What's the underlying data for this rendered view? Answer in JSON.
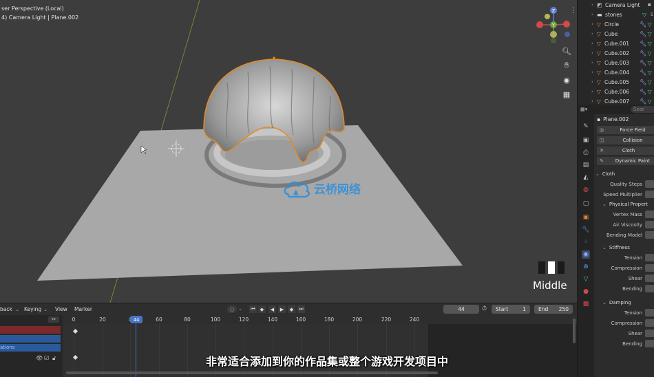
{
  "viewport": {
    "perspective_label": "ser Perspective (Local)",
    "object_label": "4) Camera Light | Plane.002",
    "view_mode_label": "Middle",
    "watermark_text": "云桥网络",
    "gizmo": {
      "z": "Z",
      "y": "Y",
      "x": "X"
    }
  },
  "outliner": {
    "items": [
      {
        "label": "Camera Light",
        "type": "camera"
      },
      {
        "label": "stones",
        "type": "collection",
        "badge": "5"
      },
      {
        "label": "Circle",
        "type": "mesh"
      },
      {
        "label": "Cube",
        "type": "mesh"
      },
      {
        "label": "Cube.001",
        "type": "mesh"
      },
      {
        "label": "Cube.002",
        "type": "mesh"
      },
      {
        "label": "Cube.003",
        "type": "mesh"
      },
      {
        "label": "Cube.004",
        "type": "mesh"
      },
      {
        "label": "Cube.005",
        "type": "mesh"
      },
      {
        "label": "Cube.006",
        "type": "mesh"
      },
      {
        "label": "Cube.007",
        "type": "mesh"
      }
    ]
  },
  "properties": {
    "search_placeholder": "Sear",
    "object_name": "Plane.002",
    "physics_buttons": [
      {
        "label": "Force Field",
        "icon": "force-field-icon"
      },
      {
        "label": "Collision",
        "icon": "collision-icon"
      },
      {
        "label": "Cloth",
        "icon": "close-icon",
        "active": true
      },
      {
        "label": "Dynamic Paint",
        "icon": "dynamic-paint-icon"
      }
    ],
    "cloth_section": "Cloth",
    "rows_top": [
      "Quality Steps",
      "Speed Multiplier"
    ],
    "physical_section": "Physical Propert",
    "rows_physical": [
      "Vertex Mass",
      "Air Viscosity",
      "Bending Model"
    ],
    "stiffness_section": "Stiffness",
    "rows_stiffness": [
      "Tension",
      "Compression",
      "Shear",
      "Bending"
    ],
    "damping_section": "Damping",
    "rows_damping": [
      "Tension",
      "Compression",
      "Shear",
      "Bending"
    ]
  },
  "timeline": {
    "menus": [
      "back",
      "Keying",
      "View",
      "Marker"
    ],
    "current_frame": "44",
    "start_label": "Start",
    "start_value": "1",
    "end_label": "End",
    "end_value": "250",
    "ruler_ticks": [
      "0",
      "20",
      "4",
      "60",
      "80",
      "100",
      "120",
      "140",
      "160",
      "180",
      "200",
      "220",
      "240"
    ],
    "channel_label": "ations"
  },
  "subtitle": "非常适合添加到你的作品集或整个游戏开发项目中",
  "colors": {
    "accent": "#4773c4",
    "mesh_orange": "#e0873a",
    "mesh_green": "#4cd07a",
    "channel_red": "#7a2a2a",
    "channel_blue": "#2b5a9a"
  }
}
